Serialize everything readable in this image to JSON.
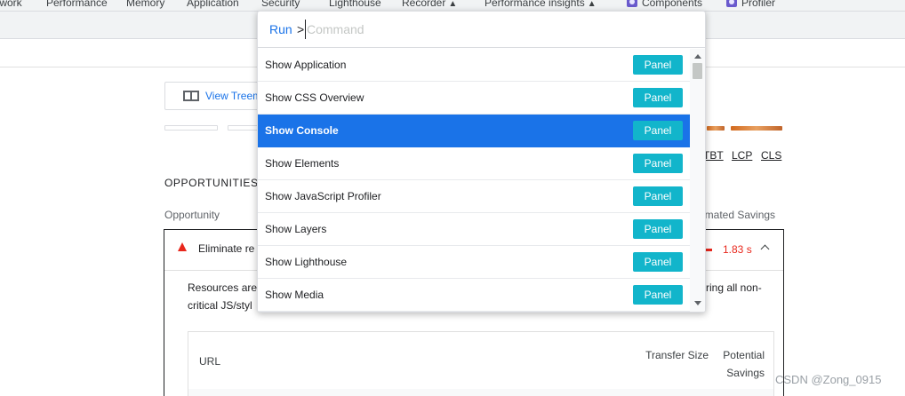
{
  "devtools_tabs": [
    {
      "label": "twork"
    },
    {
      "label": "Performance"
    },
    {
      "label": "Memory"
    },
    {
      "label": "Application"
    },
    {
      "label": "Security"
    },
    {
      "label": "Lighthouse"
    },
    {
      "label": "Recorder",
      "marker": "▲"
    },
    {
      "label": "Performance insights",
      "marker": "▲"
    },
    {
      "label": "Components"
    },
    {
      "label": "Profiler"
    }
  ],
  "report": {
    "view_treemap_label": "View Treem",
    "metric_links": [
      "TBT",
      "LCP",
      "CLS"
    ],
    "opportunities_title": "OPPORTUNITIES",
    "opportunity_col": "Opportunity",
    "savings_col": "imated Savings",
    "audit": {
      "title": "Eliminate re",
      "savings": "1.83 s",
      "description_line1": "Resources are",
      "description_line1_end": "rring all non-",
      "description_line2": "critical JS/styl",
      "table": {
        "col_url": "URL",
        "col_transfer_size": "Transfer Size",
        "col_potential_savings": "Potential Savings"
      }
    }
  },
  "command_menu": {
    "run_label": "Run",
    "prompt_symbol": ">",
    "placeholder": "Command",
    "items": [
      {
        "label": "Show Application",
        "badge": "Panel"
      },
      {
        "label": "Show CSS Overview",
        "badge": "Panel"
      },
      {
        "label": "Show Console",
        "badge": "Panel"
      },
      {
        "label": "Show Elements",
        "badge": "Panel"
      },
      {
        "label": "Show JavaScript Profiler",
        "badge": "Panel"
      },
      {
        "label": "Show Layers",
        "badge": "Panel"
      },
      {
        "label": "Show Lighthouse",
        "badge": "Panel"
      },
      {
        "label": "Show Media",
        "badge": "Panel"
      }
    ],
    "selected_item": "Show Console"
  },
  "watermark": "CSDN @Zong_0915",
  "colors": {
    "accent_blue": "#1a73e8",
    "panel_badge": "#12b5cb",
    "warning_red": "#e8271c"
  }
}
